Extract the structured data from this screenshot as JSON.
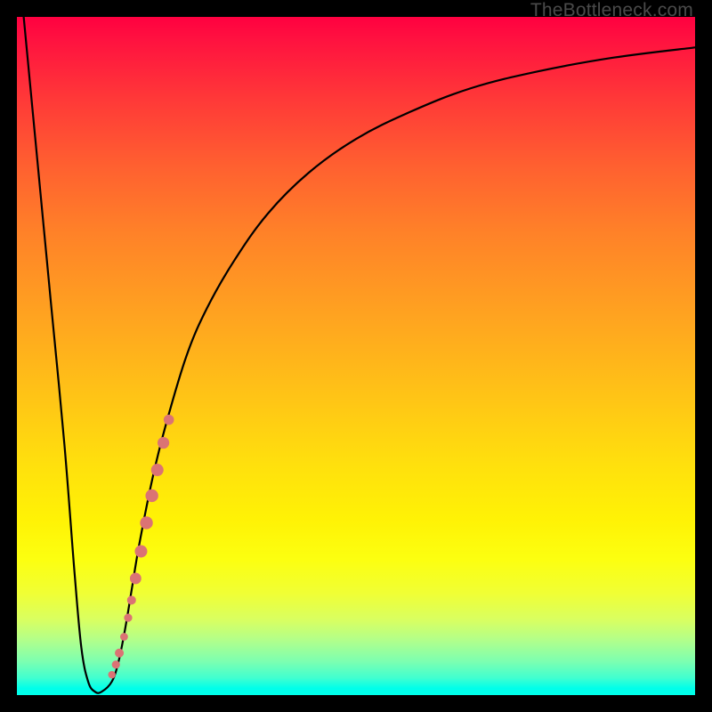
{
  "watermark": "TheBottleneck.com",
  "chart_data": {
    "type": "line",
    "title": "",
    "xlabel": "",
    "ylabel": "",
    "notes": "Bottleneck-style curve. Y maps bottleneck percentage (100% at top, 0% at bottom). X is normalized component strength 0–100. Values estimated from pixel positions; chart has no numeric axes.",
    "xlim": [
      0,
      100
    ],
    "ylim": [
      0,
      100
    ],
    "series": [
      {
        "name": "bottleneck-curve",
        "x": [
          1,
          3,
          5,
          7,
          8.5,
          9.5,
          10.5,
          11.5,
          12.5,
          14,
          15,
          16,
          17,
          18,
          20,
          22,
          25,
          28,
          32,
          37,
          43,
          50,
          58,
          67,
          77,
          88,
          100
        ],
        "y": [
          100,
          79,
          58,
          37,
          18,
          7,
          2,
          0.5,
          0.5,
          2,
          5,
          10,
          16,
          22,
          32,
          40,
          50,
          57,
          64,
          71,
          77,
          82,
          86,
          89.5,
          92,
          94,
          95.5
        ]
      }
    ],
    "scatter": {
      "name": "highlight-dots",
      "points": [
        {
          "x": 14.0,
          "y": 3.0,
          "r": 4.2
        },
        {
          "x": 14.6,
          "y": 4.5,
          "r": 4.6
        },
        {
          "x": 15.1,
          "y": 6.2,
          "r": 5.0
        },
        {
          "x": 15.8,
          "y": 8.6,
          "r": 4.4
        },
        {
          "x": 16.4,
          "y": 11.4,
          "r": 4.6
        },
        {
          "x": 16.9,
          "y": 14.0,
          "r": 5.0
        },
        {
          "x": 17.5,
          "y": 17.2,
          "r": 6.4
        },
        {
          "x": 18.3,
          "y": 21.2,
          "r": 7.0
        },
        {
          "x": 19.1,
          "y": 25.4,
          "r": 7.2
        },
        {
          "x": 19.9,
          "y": 29.4,
          "r": 7.2
        },
        {
          "x": 20.7,
          "y": 33.2,
          "r": 7.0
        },
        {
          "x": 21.6,
          "y": 37.2,
          "r": 6.6
        },
        {
          "x": 22.4,
          "y": 40.6,
          "r": 5.8
        }
      ]
    },
    "background_gradient": {
      "top": "#ff0040",
      "bottom": "#00ffea",
      "description": "Vertical red→orange→yellow→green gradient indicating bad (top) to good (bottom)."
    }
  }
}
